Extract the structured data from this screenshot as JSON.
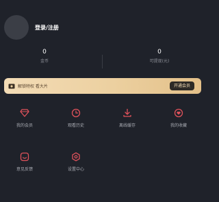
{
  "profile": {
    "login_label": "登录/注册"
  },
  "stats": {
    "coin": {
      "value": "0",
      "label": "金币"
    },
    "balance": {
      "value": "0",
      "label": "可提现(元)"
    }
  },
  "vip": {
    "text": "解锁特权 看大片",
    "button": "开通会员"
  },
  "grid": [
    {
      "label": "我的会员",
      "icon": "vip-diamond-icon"
    },
    {
      "label": "观看历史",
      "icon": "clock-icon"
    },
    {
      "label": "离线缓存",
      "icon": "download-icon"
    },
    {
      "label": "我的收藏",
      "icon": "heart-icon"
    },
    {
      "label": "意见反馈",
      "icon": "feedback-icon"
    },
    {
      "label": "设置中心",
      "icon": "settings-icon"
    }
  ],
  "colors": {
    "accent": "#e0525b",
    "background": "#1f222a",
    "gold": "#ecd0a0"
  }
}
